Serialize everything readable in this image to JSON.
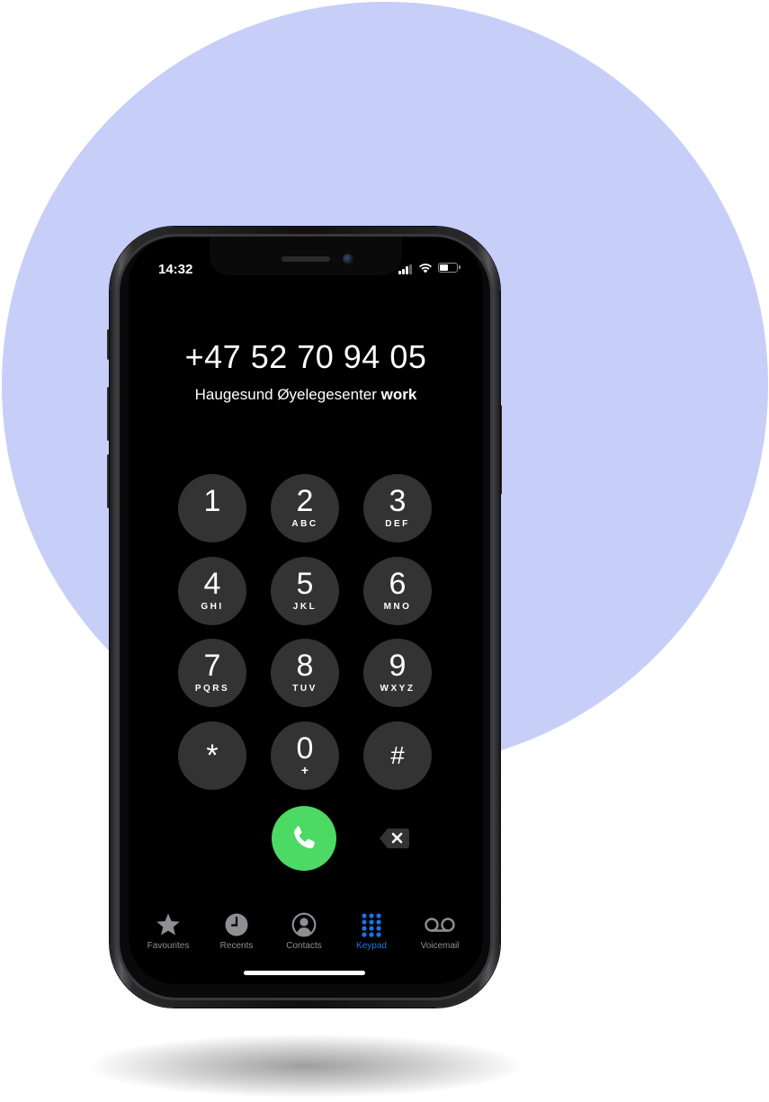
{
  "status": {
    "time": "14:32"
  },
  "dialer": {
    "number": "+47 52 70 94 05",
    "contact_name": "Haugesund Øyelegesenter",
    "contact_label": "work"
  },
  "keypad": {
    "keys": [
      {
        "digit": "1",
        "letters": ""
      },
      {
        "digit": "2",
        "letters": "ABC"
      },
      {
        "digit": "3",
        "letters": "DEF"
      },
      {
        "digit": "4",
        "letters": "GHI"
      },
      {
        "digit": "5",
        "letters": "JKL"
      },
      {
        "digit": "6",
        "letters": "MNO"
      },
      {
        "digit": "7",
        "letters": "PQRS"
      },
      {
        "digit": "8",
        "letters": "TUV"
      },
      {
        "digit": "9",
        "letters": "WXYZ"
      },
      {
        "digit": "*",
        "letters": ""
      },
      {
        "digit": "0",
        "letters": "+"
      },
      {
        "digit": "#",
        "letters": ""
      }
    ]
  },
  "tabs": [
    {
      "label": "Favourites",
      "icon": "star-icon"
    },
    {
      "label": "Recents",
      "icon": "clock-icon"
    },
    {
      "label": "Contacts",
      "icon": "person-circle-icon"
    },
    {
      "label": "Keypad",
      "icon": "keypad-grid-icon",
      "active": true
    },
    {
      "label": "Voicemail",
      "icon": "voicemail-icon"
    }
  ],
  "colors": {
    "background_circle": "#c7cef8",
    "key_fill": "#333333",
    "call_green": "#4cd964",
    "active_tab": "#1a73e8",
    "inactive_tab": "#8e8e93"
  }
}
